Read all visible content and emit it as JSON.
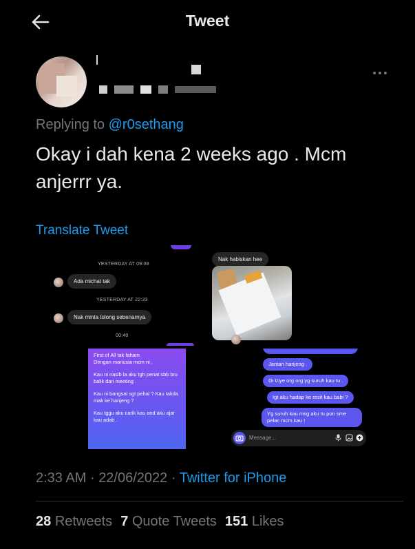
{
  "header": {
    "title": "Tweet",
    "back_icon": "arrow-left-icon"
  },
  "author": {
    "avatar": "blurred-avatar",
    "name": "",
    "handle": ""
  },
  "reply": {
    "prefix": "Replying to",
    "handle": "@r0sethang"
  },
  "tweet": {
    "text": "Okay i dah kena 2 weeks ago . Mcm anjerrr ya."
  },
  "translate_label": "Translate Tweet",
  "media": {
    "panel1": {
      "stamp1": "YESTERDAY AT 09:08",
      "msg1": "Ada michat tak",
      "stamp2": "YESTERDAY AT 22:33",
      "msg2": "Nak minta tolong sebenarnya",
      "stamp3": "00:40"
    },
    "panel2": {
      "msg1": "Nak habiskan hee"
    },
    "panel3": {
      "line1": "First of All tak faham",
      "line2": "Dengan manusia mcm ni ,",
      "para2": "Kau ni nasib la aku tgh penat sbb bru balik dari meeting .",
      "para3": "Kau ni bangsat sgt pehal ? Kau takda mak ke hanjeng ?",
      "para4": "Kau tggu aku carik kau and aku ajar kau adab ."
    },
    "panel4": {
      "msg1": "Jantan hanjeng .",
      "msg2": "Gi tnye org org yg suruh kau tu .",
      "msg3": "Igt aku hadap ke resit kau babi ?",
      "msg4": "Yg suruh kau msg aku tu pon sme pelac mcm kau !",
      "composer_placeholder": "Message..."
    }
  },
  "meta": {
    "time": "2:33 AM",
    "date": "22/06/2022",
    "source": "Twitter for iPhone",
    "sep": "·"
  },
  "stats": {
    "retweets_count": "28",
    "retweets_label": "Retweets",
    "quotes_count": "7",
    "quotes_label": "Quote Tweets",
    "likes_count": "151",
    "likes_label": "Likes"
  },
  "colors": {
    "accent": "#1d9bf0",
    "background": "#000000",
    "muted": "#71767b",
    "bubble_purple": "#5b57ee"
  }
}
